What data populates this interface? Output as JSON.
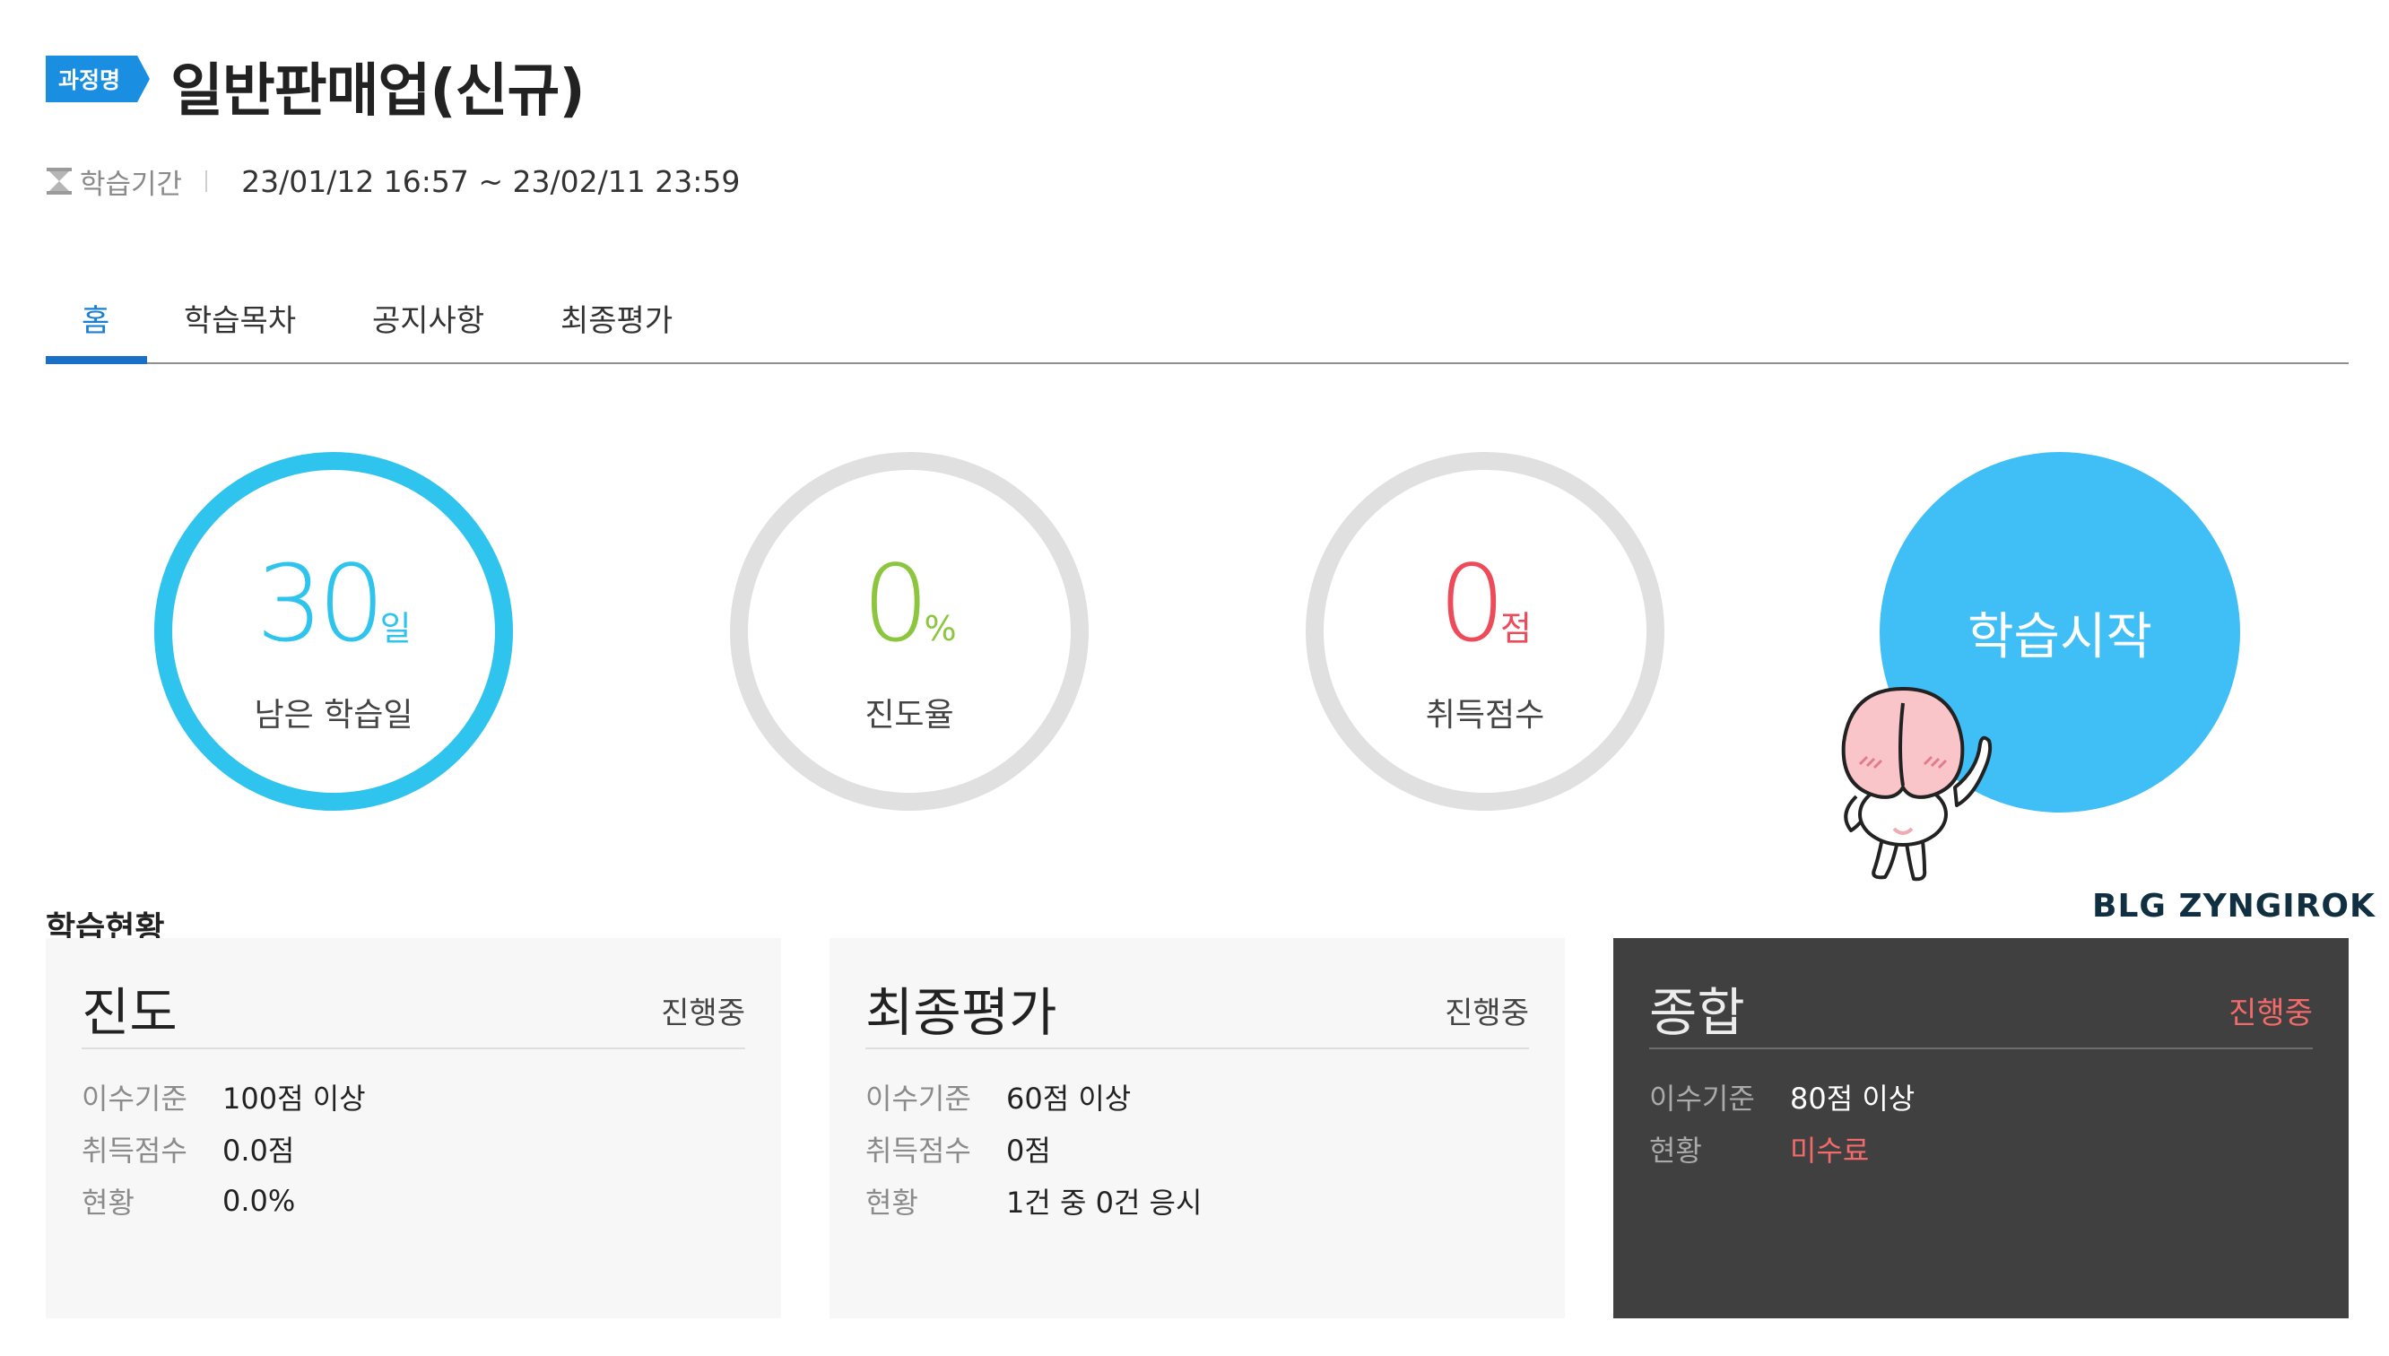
{
  "header": {
    "badge": "과정명",
    "title": "일반판매업(신규)",
    "period_label": "학습기간",
    "period_value": "23/01/12 16:57 ~ 23/02/11 23:59"
  },
  "tabs": [
    {
      "label": "홈",
      "active": true
    },
    {
      "label": "학습목차",
      "active": false
    },
    {
      "label": "공지사항",
      "active": false
    },
    {
      "label": "최종평가",
      "active": false
    }
  ],
  "stats": {
    "days_left": {
      "value": "30",
      "unit": "일",
      "label": "남은 학습일",
      "color": "#2ec4ee",
      "progress": 1.0
    },
    "progress": {
      "value": "0",
      "unit": "%",
      "label": "진도율",
      "color": "#8cc63f",
      "progress": 0.0
    },
    "score": {
      "value": "0",
      "unit": "점",
      "label": "취득점수",
      "color": "#ee4b5a",
      "progress": 0.0
    }
  },
  "start_button": {
    "label": "학습시작",
    "color": "#40bff7"
  },
  "brand": "BLG ZYNGIROK",
  "section_title": "학습현황",
  "cards": {
    "progress": {
      "title": "진도",
      "status": "진행중",
      "rows": [
        {
          "label": "이수기준",
          "value": "100점 이상"
        },
        {
          "label": "취득점수",
          "value": "0.0점"
        },
        {
          "label": "현황",
          "value": "0.0%"
        }
      ]
    },
    "final_exam": {
      "title": "최종평가",
      "status": "진행중",
      "rows": [
        {
          "label": "이수기준",
          "value": "60점 이상"
        },
        {
          "label": "취득점수",
          "value": "0점"
        },
        {
          "label": "현황",
          "value": "1건 중 0건 응시"
        }
      ]
    },
    "overall": {
      "title": "종합",
      "status": "진행중",
      "rows": [
        {
          "label": "이수기준",
          "value": "80점 이상"
        },
        {
          "label": "현황",
          "value": "미수료"
        }
      ]
    }
  },
  "colors": {
    "accent": "#1a7fd4",
    "badge": "#1a8ee0",
    "alert": "#f26a6a",
    "dark_card": "#404040"
  }
}
